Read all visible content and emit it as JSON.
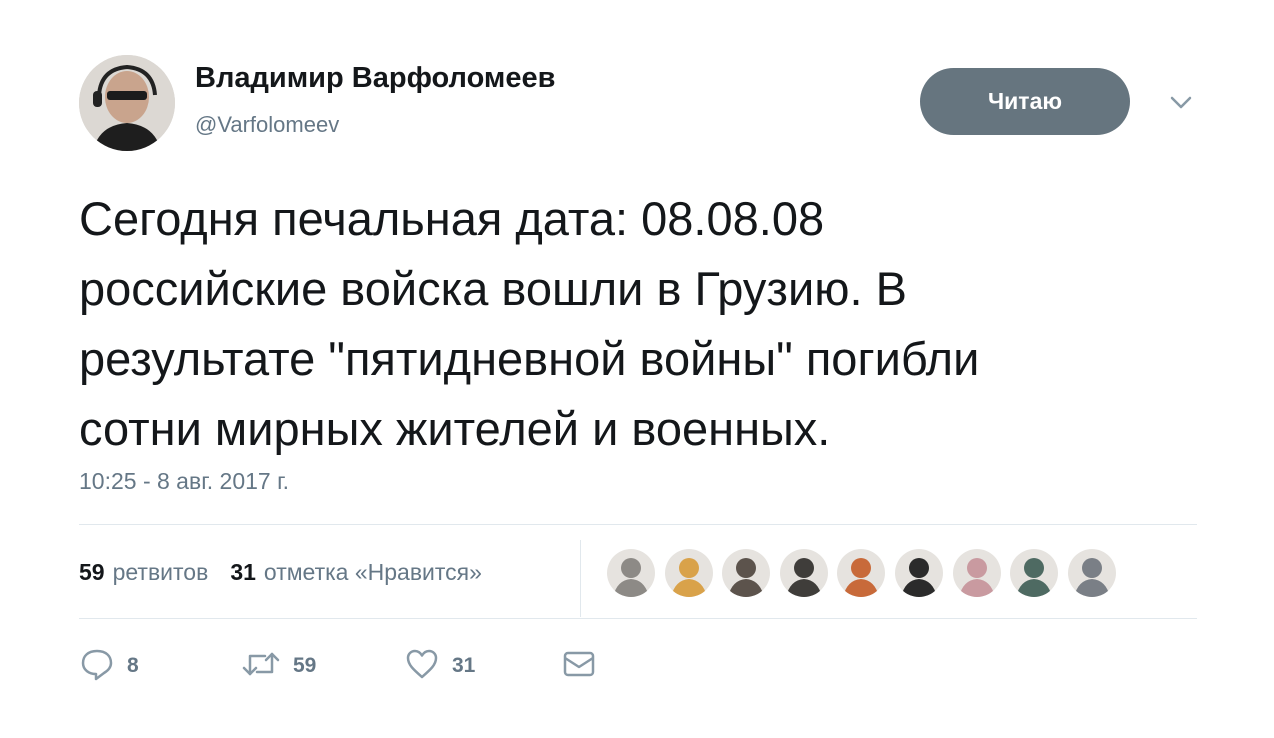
{
  "author": {
    "name": "Владимир Варфоломеев",
    "handle": "@Varfolomeev"
  },
  "follow_button": {
    "label": "Читаю"
  },
  "tweet": {
    "lines": [
      "Сегодня печальная дата: 08.08.08",
      "российские войска вошли в Грузию. В",
      "результате \"пятидневной войны\" погибли",
      "сотни мирных жителей и военных."
    ],
    "timestamp": "10:25 - 8 авг. 2017 г."
  },
  "stats": {
    "retweets_count": "59",
    "retweets_label": "ретвитов",
    "likes_count": "31",
    "likes_label": "отметка «Нравится»"
  },
  "likers": [
    {
      "name": "liker-avatar-1",
      "color": "#8d8a86"
    },
    {
      "name": "liker-avatar-2",
      "color": "#d9a24a"
    },
    {
      "name": "liker-avatar-3",
      "color": "#5c534c"
    },
    {
      "name": "liker-avatar-4",
      "color": "#3f3d3a"
    },
    {
      "name": "liker-avatar-5",
      "color": "#c86a3a"
    },
    {
      "name": "liker-avatar-6",
      "color": "#2b2b2b"
    },
    {
      "name": "liker-avatar-7",
      "color": "#c99aa0"
    },
    {
      "name": "liker-avatar-8",
      "color": "#4e6a62"
    },
    {
      "name": "liker-avatar-9",
      "color": "#7a7f86"
    }
  ],
  "actions": {
    "reply_count": "8",
    "retweet_count": "59",
    "like_count": "31"
  },
  "colors": {
    "text": "#14171a",
    "secondary": "#657786",
    "button": "#66757f",
    "divider": "#e1e8ed"
  },
  "icons": {
    "caret": "chevron-down-icon",
    "reply": "reply-icon",
    "retweet": "retweet-icon",
    "like": "heart-icon",
    "dm": "envelope-icon"
  }
}
